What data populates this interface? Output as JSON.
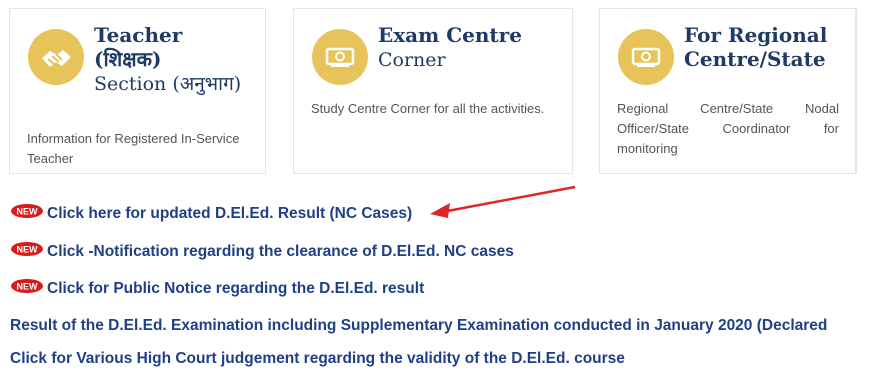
{
  "cards": [
    {
      "title_line1": "Teacher",
      "title_line2": "(शिक्षक)",
      "title_line3": "Section (अनुभाग)",
      "description": "Information for Registered In-Service Teacher",
      "icon": "handshake-icon"
    },
    {
      "title_line1": "Exam Centre",
      "title_line2": "Corner",
      "description": "Study Centre Corner for all the activities.",
      "icon": "money-icon"
    },
    {
      "title_line1": "For Regional",
      "title_line2": "Centre/State",
      "description": "Regional Centre/State Nodal Officer/State Coordinator for monitoring",
      "icon": "money-icon"
    }
  ],
  "links": [
    {
      "label": "Click here for updated D.El.Ed. Result (NC Cases)",
      "badge": "new"
    },
    {
      "label": "Click -Notification regarding the clearance of D.El.Ed. NC cases",
      "badge": "new"
    },
    {
      "label": "Click for Public Notice regarding the D.El.Ed. result",
      "badge": "new"
    },
    {
      "label": "Result of the D.El.Ed. Examination including Supplementary Examination conducted in January 2020 (Declared"
    },
    {
      "label": "Click for Various High Court judgement regarding the validity of the D.El.Ed. course"
    }
  ],
  "badge_text": "NEW",
  "colors": {
    "title": "#1f3a66",
    "link": "#1f3f86",
    "icon_bg": "#e7c35a",
    "badge": "#d81b1b",
    "arrow": "#e02525"
  }
}
